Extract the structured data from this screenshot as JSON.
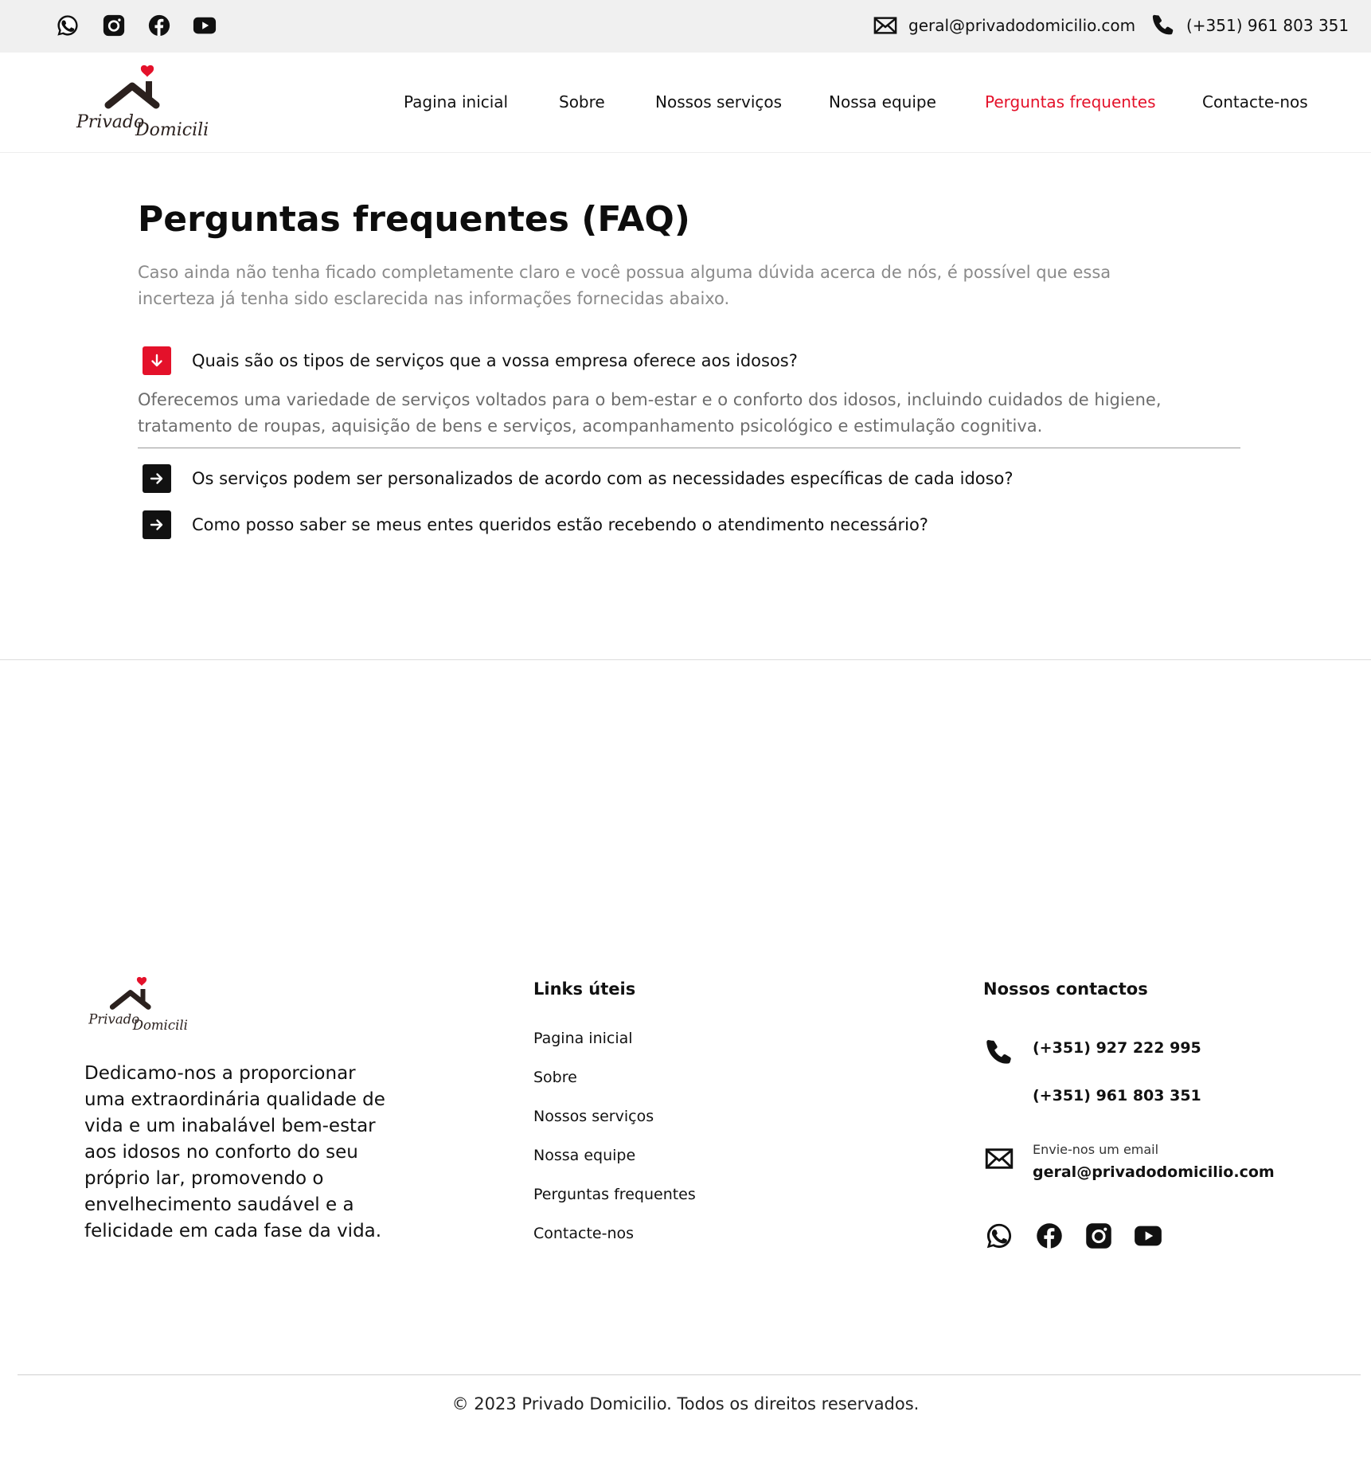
{
  "topbar": {
    "social_icons": [
      "whatsapp-icon",
      "instagram-icon",
      "facebook-icon",
      "youtube-icon"
    ],
    "email": "geral@privadodomicilio.com",
    "phone": "(+351) 961 803 351"
  },
  "brand": {
    "logo_text_1": "Privado",
    "logo_text_2": "Domicilio",
    "accent_color": "#e4112a",
    "roof_color": "#2b211e"
  },
  "nav": {
    "items": [
      {
        "label": "Pagina inicial"
      },
      {
        "label": "Sobre"
      },
      {
        "label": "Nossos serviços"
      },
      {
        "label": "Nossa equipe"
      },
      {
        "label": "Perguntas frequentes",
        "active": true
      },
      {
        "label": "Contacte-nos"
      }
    ]
  },
  "faq": {
    "title": "Perguntas frequentes (FAQ)",
    "intro": "Caso ainda não tenha ficado completamente claro e você possua alguma dúvida acerca de nós, é possível que essa incerteza já tenha sido esclarecida nas informações fornecidas abaixo.",
    "items": [
      {
        "question": "Quais são os tipos de serviços que a vossa empresa oferece aos idosos?",
        "answer": "Oferecemos uma variedade de serviços voltados para o bem-estar e o conforto dos idosos, incluindo cuidados de higiene, tratamento de roupas, aquisição de bens e serviços, acompanhamento psicológico e estimulação cognitiva.",
        "expanded": true
      },
      {
        "question": "Os serviços podem ser personalizados de acordo com as necessidades específicas de cada idoso?",
        "expanded": false
      },
      {
        "question": "Como posso saber se meus entes queridos estão recebendo o atendimento necessário?",
        "expanded": false
      }
    ]
  },
  "footer": {
    "about": "Dedicamo-nos a proporcionar uma extraordinária qualidade de vida e um inabalável bem-estar aos idosos no conforto do seu próprio lar, promovendo o envelhecimento saudável e a felicidade em cada fase da vida.",
    "links_heading": "Links úteis",
    "links": [
      "Pagina inicial",
      "Sobre",
      "Nossos serviços",
      "Nossa equipe",
      "Perguntas frequentes",
      "Contacte-nos"
    ],
    "contacts_heading": "Nossos contactos",
    "phone_1": "(+351) 927 222 995",
    "phone_2": "(+351) 961 803 351",
    "email_label": "Envie-nos um email",
    "email": "geral@privadodomicilio.com",
    "social_icons": [
      "whatsapp-icon",
      "facebook-icon",
      "instagram-icon",
      "youtube-icon"
    ],
    "copyright": "© 2023 Privado Domicilio. Todos os direitos reservados."
  }
}
